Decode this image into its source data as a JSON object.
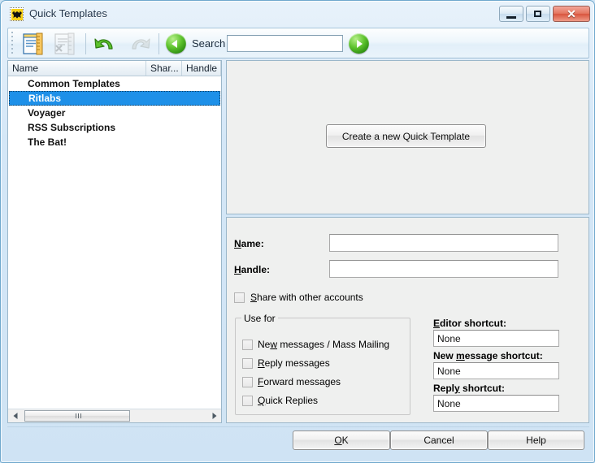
{
  "window": {
    "title": "Quick Templates",
    "icon": "bat-icon",
    "caption_buttons": [
      {
        "name": "minimize-button",
        "glyph": "minimize"
      },
      {
        "name": "maximize-button",
        "glyph": "maximize"
      },
      {
        "name": "close-button",
        "glyph": "✕"
      }
    ]
  },
  "toolbar": {
    "buttons": [
      {
        "name": "new-template-button",
        "icon": "new-template-icon",
        "enabled": true
      },
      {
        "name": "delete-template-button",
        "icon": "delete-template-icon",
        "enabled": false
      },
      {
        "name": "undo-button",
        "icon": "undo-icon",
        "enabled": true
      },
      {
        "name": "redo-button",
        "icon": "redo-icon",
        "enabled": false
      }
    ],
    "search_label": "Search",
    "search_value": "",
    "search_placeholder": "",
    "prev_button": "search-prev-icon",
    "next_button": "search-next-icon"
  },
  "tree": {
    "columns": [
      "Name",
      "Shar...",
      "Handle"
    ],
    "rows": [
      {
        "name": "Common Templates",
        "shared": "",
        "handle": "",
        "selected": false
      },
      {
        "name": "Ritlabs",
        "shared": "",
        "handle": "",
        "selected": true
      },
      {
        "name": "Voyager",
        "shared": "",
        "handle": "",
        "selected": false
      },
      {
        "name": "RSS Subscriptions",
        "shared": "",
        "handle": "",
        "selected": false
      },
      {
        "name": "The Bat!",
        "shared": "",
        "handle": "",
        "selected": false
      }
    ]
  },
  "preview": {
    "create_button": "Create a new Quick Template"
  },
  "details": {
    "name_label": "Name:",
    "name_accel": "N",
    "name_value": "",
    "handle_label": "Handle:",
    "handle_accel": "H",
    "handle_value": "",
    "share_label": "Share with other accounts",
    "share_accel": "S",
    "share_checked": false,
    "use_for_title": "Use for",
    "use_for": [
      {
        "label_pre": "Ne",
        "accel": "w",
        "label_post": " messages / Mass Mailing",
        "checked": false,
        "name": "checkbox-new-messages"
      },
      {
        "label_pre": "",
        "accel": "R",
        "label_post": "eply messages",
        "checked": false,
        "name": "checkbox-reply-messages"
      },
      {
        "label_pre": "",
        "accel": "F",
        "label_post": "orward messages",
        "checked": false,
        "name": "checkbox-forward-messages"
      },
      {
        "label_pre": "",
        "accel": "Q",
        "label_post": "uick Replies",
        "checked": false,
        "name": "checkbox-quick-replies"
      }
    ],
    "shortcuts": [
      {
        "label_pre": "",
        "accel": "E",
        "label_post": "ditor shortcut:",
        "value": "None",
        "name": "editor-shortcut"
      },
      {
        "label_pre": "New ",
        "accel": "m",
        "label_post": "essage shortcut:",
        "value": "None",
        "name": "new-message-shortcut"
      },
      {
        "label_pre": "Repl",
        "accel": "y",
        "label_post": " shortcut:",
        "value": "None",
        "name": "reply-shortcut"
      }
    ]
  },
  "footer": {
    "ok_pre": "",
    "ok_accel": "O",
    "ok_post": "K",
    "cancel": "Cancel",
    "help": "Help"
  }
}
